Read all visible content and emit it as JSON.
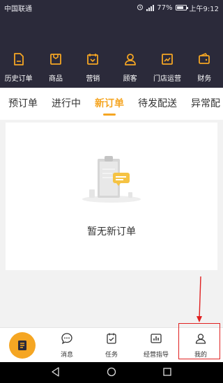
{
  "status_bar": {
    "carrier": "中国联通",
    "battery_text": "77%",
    "battery_level": 0.77,
    "time": "上午9:12"
  },
  "quick_menu": [
    {
      "label": "历史订单",
      "icon": "order-history-icon"
    },
    {
      "label": "商品",
      "icon": "goods-icon"
    },
    {
      "label": "营销",
      "icon": "marketing-icon"
    },
    {
      "label": "顾客",
      "icon": "customer-icon"
    },
    {
      "label": "门店运营",
      "icon": "store-operation-icon"
    },
    {
      "label": "财务",
      "icon": "finance-icon"
    }
  ],
  "tabs": [
    {
      "label": "预订单",
      "active": false
    },
    {
      "label": "进行中",
      "active": false
    },
    {
      "label": "新订单",
      "active": true
    },
    {
      "label": "待发配送",
      "active": false
    },
    {
      "label": "异常配",
      "active": false
    }
  ],
  "empty_state": {
    "message": "暂无新订单"
  },
  "bottom_nav": [
    {
      "label": "消息",
      "icon": "message-icon"
    },
    {
      "label": "任务",
      "icon": "task-icon"
    },
    {
      "label": "经营指导",
      "icon": "business-guide-icon"
    },
    {
      "label": "我的",
      "icon": "profile-icon"
    }
  ],
  "colors": {
    "accent": "#f5a623",
    "header_bg": "#2b2a3a",
    "highlight": "#e02020"
  }
}
